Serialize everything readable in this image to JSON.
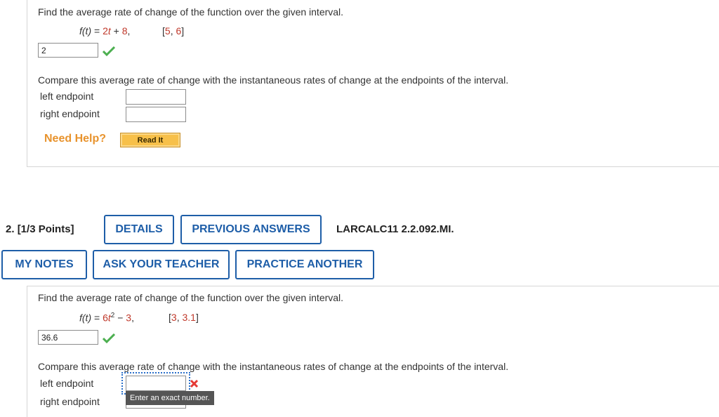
{
  "q1": {
    "prompt": "Find the average rate of change of the function over the given interval.",
    "function": {
      "lhs": "f(t)",
      "eq": " = ",
      "coef": "2",
      "var": "t",
      "rest": " + 8,",
      "interval": "[5, 6]"
    },
    "answer_value": "2",
    "compare_prompt": "Compare this average rate of change with the instantaneous rates of change at the endpoints of the interval.",
    "left_label": "left endpoint",
    "right_label": "right endpoint",
    "need_help": "Need Help?",
    "read_it": "Read It"
  },
  "q2_header": {
    "number": "2.",
    "points": "[1/3 Points]",
    "details": "DETAILS",
    "previous_answers": "PREVIOUS ANSWERS",
    "code": "LARCALC11 2.2.092.MI.",
    "my_notes": "MY NOTES",
    "ask_teacher": "ASK YOUR TEACHER",
    "practice_another": "PRACTICE ANOTHER"
  },
  "q2": {
    "prompt": "Find the average rate of change of the function over the given interval.",
    "function": {
      "lhs": "f(t)",
      "eq": " = ",
      "coef": "6",
      "var": "t",
      "exp": "2",
      "minus": " − ",
      "const": "3",
      "comma": ",",
      "interval_open": "[",
      "int_a": "3",
      "int_sep": ", ",
      "int_b": "3.1",
      "interval_close": "]"
    },
    "answer_value": "36.6",
    "compare_prompt": "Compare this average rate of change with the instantaneous rates of change at the endpoints of the interval.",
    "left_label": "left endpoint",
    "right_label": "right endpoint",
    "tooltip": "Enter an exact number."
  },
  "colors": {
    "accent": "#1e5ea8",
    "math_red": "#c0392b",
    "check_green": "#4caf50",
    "error_red": "#e53935",
    "need_help_orange": "#e8932d"
  }
}
